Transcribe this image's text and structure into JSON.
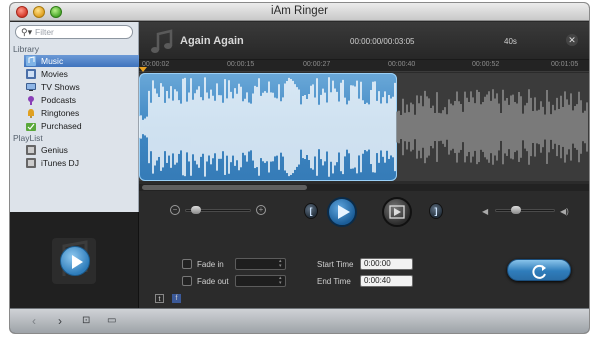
{
  "window": {
    "title": "iAm Ringer"
  },
  "sidebar": {
    "search": {
      "placeholder": "Filter",
      "value": ""
    },
    "library_header": "Library",
    "library_items": [
      {
        "label": "Music",
        "icon": "music-icon",
        "selected": true
      },
      {
        "label": "Movies",
        "icon": "movies-icon",
        "selected": false
      },
      {
        "label": "TV Shows",
        "icon": "tv-icon",
        "selected": false
      },
      {
        "label": "Podcasts",
        "icon": "podcast-icon",
        "selected": false
      },
      {
        "label": "Ringtones",
        "icon": "bell-icon",
        "selected": false
      },
      {
        "label": "Purchased",
        "icon": "purchased-icon",
        "selected": false
      }
    ],
    "playlist_header": "PlayList",
    "playlist_items": [
      {
        "label": "Genius",
        "icon": "playlist-icon"
      },
      {
        "label": "iTunes DJ",
        "icon": "playlist-icon"
      }
    ]
  },
  "header": {
    "song_title": "Again Again",
    "time_readout": "00:00:00/00:03:05",
    "duration": "40s"
  },
  "ruler": {
    "ticks": [
      "00:00:02",
      "00:00:15",
      "00:00:27",
      "00:00:40",
      "00:00:52",
      "00:01:05"
    ]
  },
  "controls": {
    "fade_in_label": "Fade  in",
    "fade_out_label": "Fade  out",
    "start_time_label": "Start Time",
    "start_time_value": "0:00:00",
    "end_time_label": "End  Time",
    "end_time_value": "0:00:40",
    "zoom_level": 0.2,
    "volume_level": 0.4
  },
  "colors": {
    "selection": "#3f87c3",
    "accent": "#2f7dbb"
  }
}
